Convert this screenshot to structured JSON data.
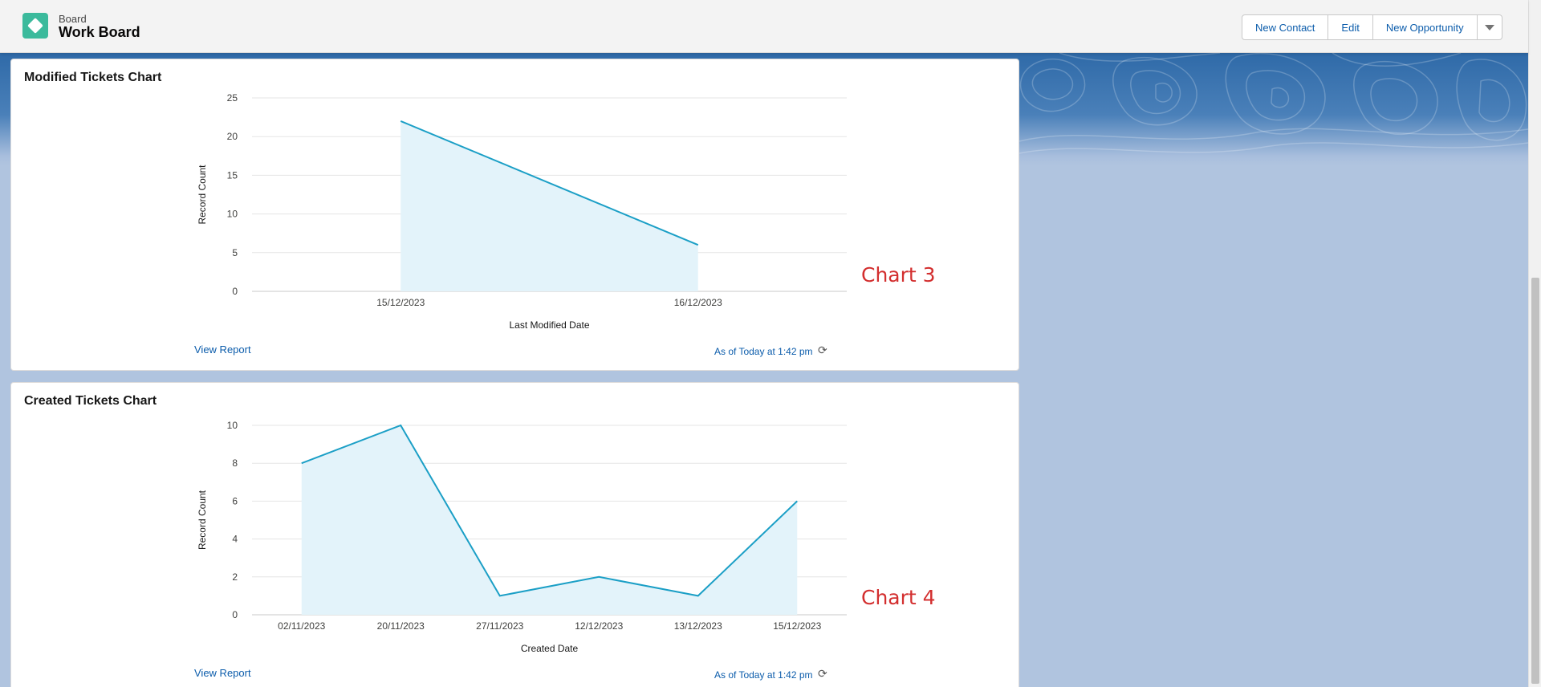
{
  "header": {
    "object_label": "Board",
    "record_name": "Work Board",
    "buttons": [
      "New Contact",
      "Edit",
      "New Opportunity"
    ],
    "menu_icon": "chevron-down-icon"
  },
  "colors": {
    "accent": "#0b5cab",
    "line": "#1b9fc6",
    "area": "#e3f3fa",
    "app_icon": "#3bba9c",
    "annotation": "#d32f2f"
  },
  "cards": [
    {
      "title": "Modified Tickets Chart",
      "view_report": "View Report",
      "as_of": "As of Today at 1:42 pm",
      "annotation": "Chart 3"
    },
    {
      "title": "Created Tickets Chart",
      "view_report": "View Report",
      "as_of": "As of Today at 1:42 pm",
      "annotation": "Chart 4"
    }
  ],
  "chart_data": [
    {
      "type": "area",
      "title": "Modified Tickets Chart",
      "xlabel": "Last Modified Date",
      "ylabel": "Record Count",
      "categories": [
        "15/12/2023",
        "16/12/2023"
      ],
      "values": [
        22,
        6
      ],
      "ylim": [
        0,
        25
      ],
      "yticks": [
        0,
        5,
        10,
        15,
        20,
        25
      ],
      "grid": true
    },
    {
      "type": "area",
      "title": "Created Tickets Chart",
      "xlabel": "Created Date",
      "ylabel": "Record Count",
      "categories": [
        "02/11/2023",
        "20/11/2023",
        "27/11/2023",
        "12/12/2023",
        "13/12/2023",
        "15/12/2023"
      ],
      "values": [
        8,
        10,
        1,
        2,
        1,
        6
      ],
      "ylim": [
        0,
        10
      ],
      "yticks": [
        0,
        2,
        4,
        6,
        8,
        10
      ],
      "grid": true
    }
  ]
}
